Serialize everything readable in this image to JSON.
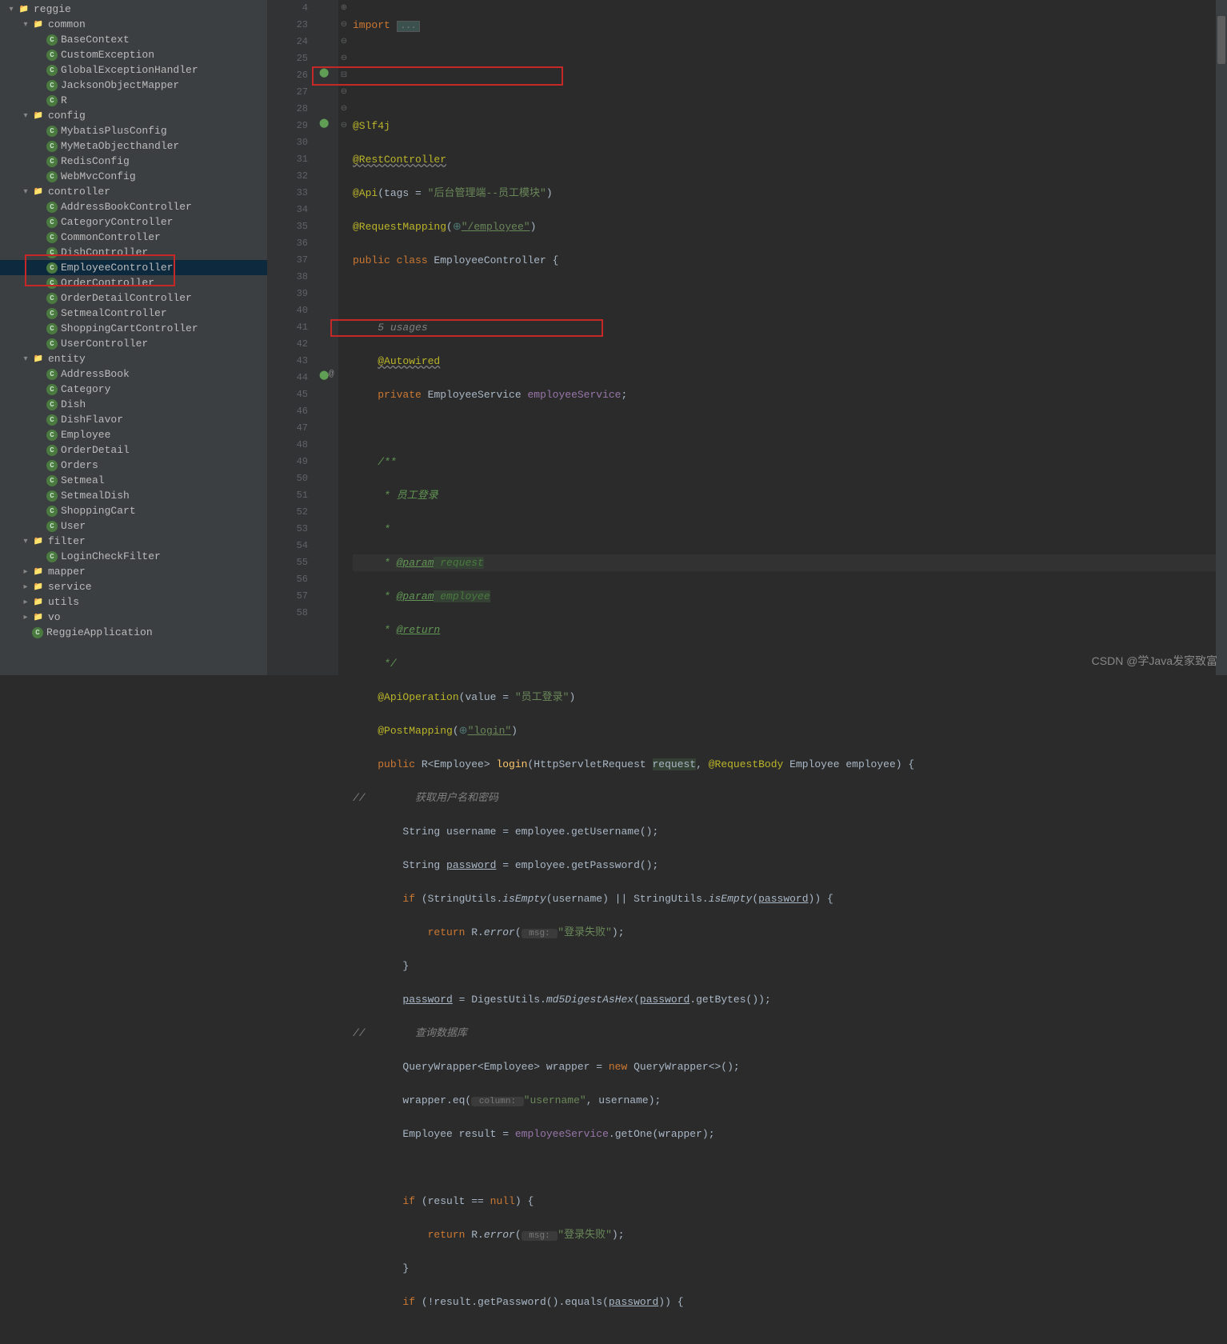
{
  "tree": [
    {
      "indent": 0,
      "arrow": "down",
      "icon": "folder",
      "label": "reggie"
    },
    {
      "indent": 1,
      "arrow": "down",
      "icon": "folder",
      "label": "common"
    },
    {
      "indent": 2,
      "arrow": "none",
      "icon": "class",
      "label": "BaseContext"
    },
    {
      "indent": 2,
      "arrow": "none",
      "icon": "class",
      "label": "CustomException"
    },
    {
      "indent": 2,
      "arrow": "none",
      "icon": "class",
      "label": "GlobalExceptionHandler"
    },
    {
      "indent": 2,
      "arrow": "none",
      "icon": "class",
      "label": "JacksonObjectMapper"
    },
    {
      "indent": 2,
      "arrow": "none",
      "icon": "class",
      "label": "R"
    },
    {
      "indent": 1,
      "arrow": "down",
      "icon": "folder",
      "label": "config"
    },
    {
      "indent": 2,
      "arrow": "none",
      "icon": "class",
      "label": "MybatisPlusConfig"
    },
    {
      "indent": 2,
      "arrow": "none",
      "icon": "class",
      "label": "MyMetaObjecthandler"
    },
    {
      "indent": 2,
      "arrow": "none",
      "icon": "class",
      "label": "RedisConfig"
    },
    {
      "indent": 2,
      "arrow": "none",
      "icon": "class",
      "label": "WebMvcConfig"
    },
    {
      "indent": 1,
      "arrow": "down",
      "icon": "folder",
      "label": "controller"
    },
    {
      "indent": 2,
      "arrow": "none",
      "icon": "class",
      "label": "AddressBookController"
    },
    {
      "indent": 2,
      "arrow": "none",
      "icon": "class",
      "label": "CategoryController"
    },
    {
      "indent": 2,
      "arrow": "none",
      "icon": "class",
      "label": "CommonController"
    },
    {
      "indent": 2,
      "arrow": "none",
      "icon": "class",
      "label": "DishController"
    },
    {
      "indent": 2,
      "arrow": "none",
      "icon": "class",
      "label": "EmployeeController",
      "selected": true
    },
    {
      "indent": 2,
      "arrow": "none",
      "icon": "class",
      "label": "OrderController"
    },
    {
      "indent": 2,
      "arrow": "none",
      "icon": "class",
      "label": "OrderDetailController"
    },
    {
      "indent": 2,
      "arrow": "none",
      "icon": "class",
      "label": "SetmealController"
    },
    {
      "indent": 2,
      "arrow": "none",
      "icon": "class",
      "label": "ShoppingCartController"
    },
    {
      "indent": 2,
      "arrow": "none",
      "icon": "class",
      "label": "UserController"
    },
    {
      "indent": 1,
      "arrow": "down",
      "icon": "folder",
      "label": "entity"
    },
    {
      "indent": 2,
      "arrow": "none",
      "icon": "class",
      "label": "AddressBook"
    },
    {
      "indent": 2,
      "arrow": "none",
      "icon": "class",
      "label": "Category"
    },
    {
      "indent": 2,
      "arrow": "none",
      "icon": "class",
      "label": "Dish"
    },
    {
      "indent": 2,
      "arrow": "none",
      "icon": "class",
      "label": "DishFlavor"
    },
    {
      "indent": 2,
      "arrow": "none",
      "icon": "class",
      "label": "Employee"
    },
    {
      "indent": 2,
      "arrow": "none",
      "icon": "class",
      "label": "OrderDetail"
    },
    {
      "indent": 2,
      "arrow": "none",
      "icon": "class",
      "label": "Orders"
    },
    {
      "indent": 2,
      "arrow": "none",
      "icon": "class",
      "label": "Setmeal"
    },
    {
      "indent": 2,
      "arrow": "none",
      "icon": "class",
      "label": "SetmealDish"
    },
    {
      "indent": 2,
      "arrow": "none",
      "icon": "class",
      "label": "ShoppingCart"
    },
    {
      "indent": 2,
      "arrow": "none",
      "icon": "class",
      "label": "User"
    },
    {
      "indent": 1,
      "arrow": "down",
      "icon": "folder",
      "label": "filter"
    },
    {
      "indent": 2,
      "arrow": "none",
      "icon": "class",
      "label": "LoginCheckFilter"
    },
    {
      "indent": 1,
      "arrow": "right",
      "icon": "folder",
      "label": "mapper"
    },
    {
      "indent": 1,
      "arrow": "right",
      "icon": "folder",
      "label": "service"
    },
    {
      "indent": 1,
      "arrow": "right",
      "icon": "folder",
      "label": "utils"
    },
    {
      "indent": 1,
      "arrow": "right",
      "icon": "folder",
      "label": "vo"
    },
    {
      "indent": 1,
      "arrow": "none",
      "icon": "class",
      "label": "ReggieApplication"
    }
  ],
  "lines": [
    "4",
    "",
    "23",
    "24",
    "25",
    "26",
    "27",
    "28",
    "29",
    "",
    "30",
    "31",
    "32",
    "33",
    "34",
    "35",
    "36",
    "37",
    "38",
    "39",
    "40",
    "41",
    "42",
    "43",
    "44",
    "45",
    "46",
    "47",
    "48",
    "49",
    "50",
    "51",
    "52",
    "53",
    "54",
    "55",
    "56",
    "57",
    "58"
  ],
  "code": {
    "l4_1": "import ",
    "l4_2": "...",
    "l24": "@Slf4j",
    "l25": "@RestController",
    "l26_1": "@Api",
    "l26_2": "(tags = ",
    "l26_3": "\"后台管理端--员工模块\"",
    "l26_4": ")",
    "l27_1": "@RequestMapping",
    "l27_2": "(",
    "l27_3": "\"/employee\"",
    "l27_4": ")",
    "l28_1": "public class ",
    "l28_2": "EmployeeController {",
    "l30_usage": "5 usages",
    "l30": "@Autowired",
    "l31_1": "private ",
    "l31_2": "EmployeeService ",
    "l31_3": "employeeService",
    "l31_4": ";",
    "l33": "/**",
    "l34": " * 员工登录",
    "l35": " *",
    "l36_1": " * ",
    "l36_2": "@param",
    "l36_3": " request",
    "l37_1": " * ",
    "l37_2": "@param",
    "l37_3": " employee",
    "l38_1": " * ",
    "l38_2": "@return",
    "l39": " */",
    "l40_1": "@ApiOperation",
    "l40_2": "(value = ",
    "l40_3": "\"员工登录\"",
    "l40_4": ")",
    "l41_1": "@PostMapping",
    "l41_2": "(",
    "l41_3": "\"login\"",
    "l41_4": ")",
    "l42_1": "public ",
    "l42_2": "R<Employee> ",
    "l42_3": "login",
    "l42_4": "(HttpServletRequest ",
    "l42_5": "request",
    "l42_6": ", ",
    "l42_7": "@RequestBody",
    "l42_8": " Employee employee) {",
    "l43_1": "//",
    "l43_2": "        获取用户名和密码",
    "l44_1": "String username = employee.getUsername();",
    "l45_1": "String ",
    "l45_2": "password",
    "l45_3": " = employee.getPassword();",
    "l46_1": "if ",
    "l46_2": "(StringUtils.",
    "l46_3": "isEmpty",
    "l46_4": "(username) || StringUtils.",
    "l46_5": "isEmpty",
    "l46_6": "(",
    "l46_7": "password",
    "l46_8": ")) {",
    "l47_1": "return ",
    "l47_2": "R.",
    "l47_3": "error",
    "l47_4": "(",
    "l47_5": " msg: ",
    "l47_6": "\"登录失败\"",
    "l47_7": ");",
    "l48": "}",
    "l49_1": "password",
    "l49_2": " = DigestUtils.",
    "l49_3": "md5DigestAsHex",
    "l49_4": "(",
    "l49_5": "password",
    "l49_6": ".getBytes());",
    "l50_1": "//",
    "l50_2": "        查询数据库",
    "l51_1": "QueryWrapper<Employee> wrapper = ",
    "l51_2": "new ",
    "l51_3": "QueryWrapper<>();",
    "l52_1": "wrapper.eq(",
    "l52_2": " column: ",
    "l52_3": "\"username\"",
    "l52_4": ", username);",
    "l53_1": "Employee result = ",
    "l53_2": "employeeService",
    "l53_3": ".getOne(wrapper);",
    "l55_1": "if ",
    "l55_2": "(result == ",
    "l55_3": "null",
    "l55_4": ") {",
    "l56_1": "return ",
    "l56_2": "R.",
    "l56_3": "error",
    "l56_4": "(",
    "l56_5": " msg: ",
    "l56_6": "\"登录失败\"",
    "l56_7": ");",
    "l57": "}",
    "l58_1": "if ",
    "l58_2": "(!result.getPassword().equals(",
    "l58_3": "password",
    "l58_4": ")) {"
  },
  "watermark": "CSDN @学Java发家致富"
}
